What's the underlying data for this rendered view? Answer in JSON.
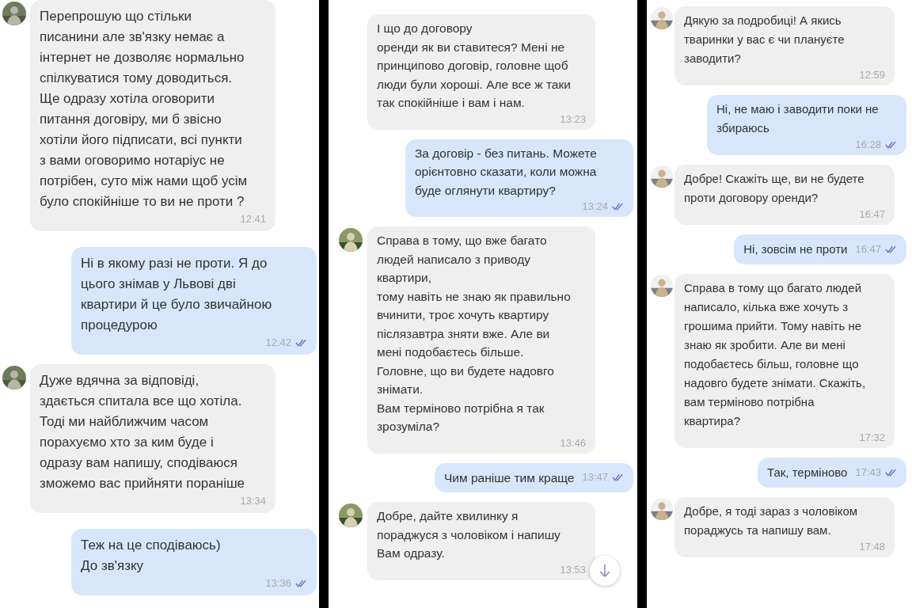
{
  "panels": [
    {
      "messages": [
        {
          "kind": "incoming",
          "avatar": true,
          "text": "Перепрошую що стільки\nписанини але зв'язку немає а\nінтернет не дозволяє нормально\nспілкуватися тому доводиться.\nЩе одразу хотіла оговорити\nпитання договіру, ми б звісно\nхотіли його підписати, всі пункти\nз вами оговоримо нотаріус не\nпотрібен, суто між нами щоб усім\nбуло спокійніше то ви не проти ?",
          "time": "12:41"
        },
        {
          "kind": "outgoing",
          "text": "Ні в якому разі не проти. Я до\nцього знімав у Львові дві\nквартири й це було звичайною\nпроцедурою",
          "time": "12:42",
          "read": true
        },
        {
          "kind": "incoming",
          "avatar": true,
          "text": "Дуже вдячна за відповіді,\nздається спитала все що хотіла.\nТоді ми найближчим часом\nпорахуємо хто за ким буде і\nодразу вам напишу, сподіваюся\nзможемо вас прийняти пораніше",
          "time": "13:34"
        },
        {
          "kind": "outgoing",
          "text": "Теж на це сподіваюсь)\nДо зв'язку",
          "time": "13:36",
          "read": true
        }
      ]
    },
    {
      "scroll_down": true,
      "messages": [
        {
          "kind": "incoming",
          "avatar": false,
          "text": "І що до договору\nоренди як ви ставитеся? Мені не\nпринципово договір, головне щоб\nлюди були хороші. Але все ж таки\nтак спокійніше і вам і нам.",
          "time": "13:23"
        },
        {
          "kind": "outgoing",
          "text": "За договір - без питань. Можете\nорієнтовно сказати, коли можна\nбуде оглянути квартиру?",
          "time": "13:24",
          "read": true
        },
        {
          "kind": "incoming",
          "avatar": true,
          "text": "Справа в тому, що вже багато\nлюдей написало з приводу\nквартири,\nтому навіть не знаю як правильно\nвчинити, троє хочуть квартиру\nпіслязавтра зняти вже. Але ви\nмені подобаєтесь більше.\nГоловне, що ви будете надовго\nзнімати.\nВам терміново потрібна я так\nзрозуміла?",
          "time": "13:46"
        },
        {
          "kind": "outgoing",
          "text": "Чим раніше тим краще",
          "time": "13:47",
          "read": true
        },
        {
          "kind": "incoming",
          "avatar": true,
          "text": "Добре, дайте хвилинку я\nпораджуся з чоловіком і напишу\nВам одразу.",
          "time": "13:53"
        }
      ]
    },
    {
      "messages": [
        {
          "kind": "incoming",
          "avatar": true,
          "text": "Дякую за подробиці! А якись\nтваринки у вас є чи плануєте\nзаводити?",
          "time": "12:59"
        },
        {
          "kind": "outgoing",
          "text": "Ні, не маю і заводити поки не\nзбираюсь",
          "time": "16:28",
          "read": true
        },
        {
          "kind": "incoming",
          "avatar": true,
          "text": "Добре! Скажіть ще, ви не будете\nпроти договору оренди?",
          "time": "16:47"
        },
        {
          "kind": "outgoing",
          "text": "Ні, зовсім не проти",
          "time": "16:47",
          "read": true
        },
        {
          "kind": "incoming",
          "avatar": true,
          "text": "Справа в тому що багато людей\nнаписало, кілька вже хочуть з\nгрошима прийти. Тому навіть не\nзнаю як зробити. Але ви мені\nподобаєтесь більш, головне що\nнадовго будете знімати. Скажіть,\nвам терміново потрібна\nквартира?",
          "time": "17:32"
        },
        {
          "kind": "outgoing",
          "text": "Так, терміново",
          "time": "17:43",
          "read": true
        },
        {
          "kind": "incoming",
          "avatar": true,
          "text": "Добре, я тоді зараз з чоловіком\nпораджусь та напишу вам.",
          "time": "17:48"
        }
      ]
    }
  ]
}
